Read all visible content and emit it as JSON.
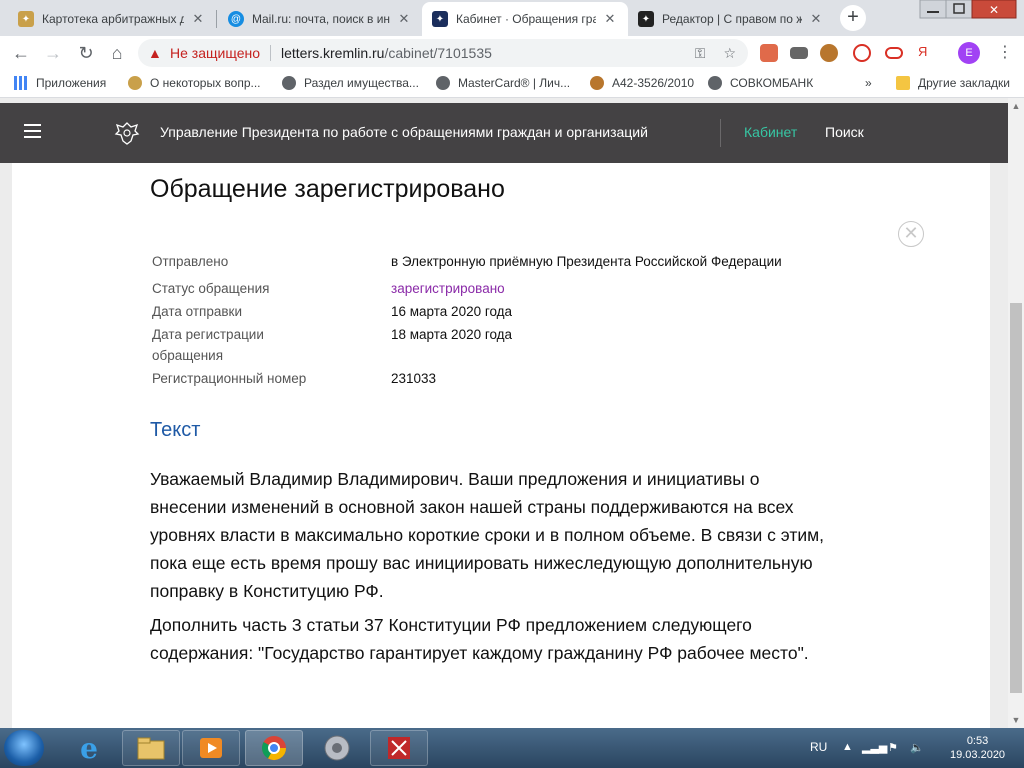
{
  "browser": {
    "tabs": [
      {
        "title": "Картотека арбитражных д",
        "active": false
      },
      {
        "title": "Mail.ru: почта, поиск в ин",
        "active": false
      },
      {
        "title": "Кабинет · Обращения гра",
        "active": true
      },
      {
        "title": "Редактор | С правом по ж",
        "active": false
      }
    ],
    "security_label": "Не защищено",
    "url_host": "letters.kremlin.ru",
    "url_path": "/cabinet/7101535",
    "profile_initial": "E"
  },
  "bookmarks": {
    "items": [
      "Приложения",
      "О некоторых вопр...",
      "Раздел имущества...",
      "MasterCard® | Лич...",
      "А42-3526/2010",
      "СОВКОМБАНК"
    ],
    "overflow": "»",
    "other": "Другие закладки"
  },
  "site": {
    "title": "Управление Президента по работе с обращениями граждан и организаций",
    "nav_cabinet": "Кабинет",
    "nav_search": "Поиск"
  },
  "appeal": {
    "heading": "Обращение зарегистрировано",
    "fields": [
      {
        "key": "Отправлено",
        "value": "в Электронную приёмную Президента Российской Федерации"
      },
      {
        "key": "Статус обращения",
        "value": "зарегистрировано"
      },
      {
        "key": "Дата отправки",
        "value": "16 марта 2020 года"
      },
      {
        "key": "Дата регистрации обращения",
        "value": "18 марта 2020 года"
      },
      {
        "key": "Регистрационный номер",
        "value": "231033"
      }
    ],
    "text_heading": "Текст",
    "paragraphs": [
      "Уважаемый Владимир Владимирович. Ваши предложения и инициативы о внесении изменений в основной закон нашей страны поддерживаются на всех уровнях власти в максимально короткие сроки и в полном объеме. В связи с этим, пока еще есть время прошу вас инициировать нижеследующую дополнительную поправку в Конституцию РФ.",
      "Дополнить часть 3 статьи 37 Конституции РФ предложением следующего содержания: \"Государство гарантирует каждому гражданину РФ рабочее место\"."
    ]
  },
  "taskbar": {
    "lang": "RU",
    "time": "0:53",
    "date": "19.03.2020"
  },
  "colors": {
    "header_bg": "#444244",
    "nav_active": "#37c6a4",
    "status": "#8a2aa8",
    "subtitle": "#1f5aa6"
  }
}
